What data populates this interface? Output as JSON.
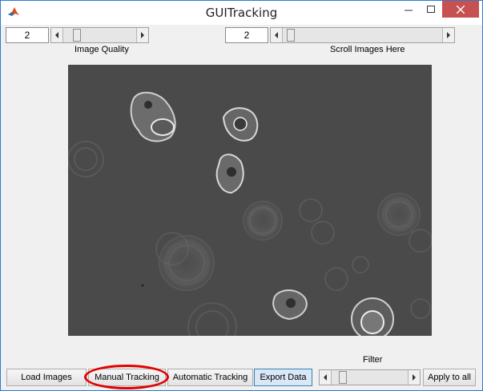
{
  "window": {
    "title": "GUITracking",
    "icon": "matlab-icon",
    "close_color": "#c75050"
  },
  "controls": {
    "image_quality_value": "2",
    "image_quality_label": "Image Quality",
    "scroll_value": "2",
    "scroll_label": "Scroll Images Here",
    "filter_label": "Filter"
  },
  "buttons": {
    "load_images": "Load Images",
    "manual_tracking": "Manual Tracking",
    "automatic_tracking": "Automatic Tracking",
    "export_data": "Export Data",
    "apply_to_all": "Apply to all"
  },
  "highlight": {
    "target": "manual_tracking",
    "color": "#e20000"
  }
}
